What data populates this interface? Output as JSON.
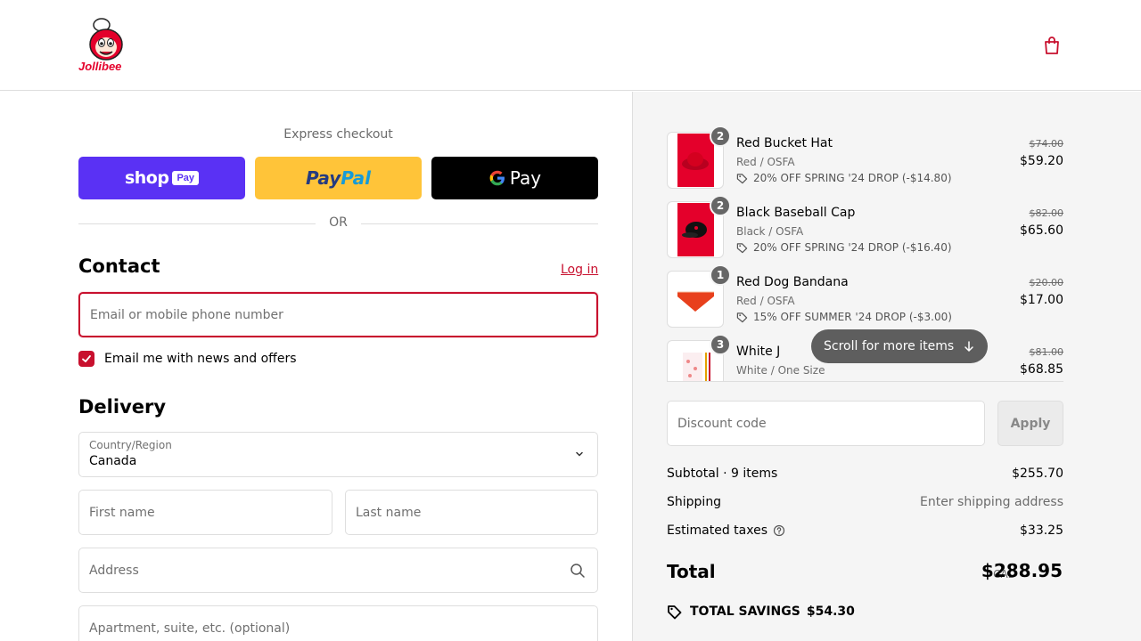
{
  "brand": {
    "name": "Jollibee",
    "accent": "#c8102e"
  },
  "header": {
    "cart_icon": "shopping-bag-icon"
  },
  "express": {
    "title": "Express checkout",
    "shop_pay": {
      "word": "shop",
      "box": "Pay"
    },
    "paypal": {
      "part1": "Pay",
      "part2": "Pal"
    },
    "gpay": {
      "word": "Pay"
    },
    "or": "OR"
  },
  "contact": {
    "title": "Contact",
    "login": "Log in",
    "email_placeholder": "Email or mobile phone number",
    "newsletter_label": "Email me with news and offers",
    "newsletter_checked": true
  },
  "delivery": {
    "title": "Delivery",
    "country_label": "Country/Region",
    "country_value": "Canada",
    "first_name_placeholder": "First name",
    "last_name_placeholder": "Last name",
    "address_placeholder": "Address",
    "apartment_placeholder": "Apartment, suite, etc. (optional)"
  },
  "cart": {
    "items": [
      {
        "qty": "2",
        "name": "Red Bucket Hat",
        "variant": "Red / OSFA",
        "discount": "20% OFF SPRING '24 DROP (-$14.80)",
        "original": "$74.00",
        "price": "$59.20"
      },
      {
        "qty": "2",
        "name": "Black Baseball Cap",
        "variant": "Black / OSFA",
        "discount": "20% OFF SPRING '24 DROP (-$16.40)",
        "original": "$82.00",
        "price": "$65.60"
      },
      {
        "qty": "1",
        "name": "Red Dog Bandana",
        "variant": "Red / OSFA",
        "discount": "15% OFF SUMMER '24 DROP (-$3.00)",
        "original": "$20.00",
        "price": "$17.00"
      },
      {
        "qty": "3",
        "name": "White J",
        "variant": "White / One Size",
        "discount": "",
        "original": "$81.00",
        "price": "$68.85"
      }
    ],
    "scroll_hint": "Scroll for more items",
    "discount_placeholder": "Discount code",
    "apply_label": "Apply"
  },
  "summary": {
    "subtotal_label": "Subtotal · 9 items",
    "subtotal_value": "$255.70",
    "shipping_label": "Shipping",
    "shipping_value": "Enter shipping address",
    "taxes_label": "Estimated taxes",
    "taxes_value": "$33.25",
    "total_label": "Total",
    "total_currency": "CAD",
    "total_value": "$288.95",
    "savings_label": "TOTAL SAVINGS",
    "savings_value": "$54.30"
  }
}
